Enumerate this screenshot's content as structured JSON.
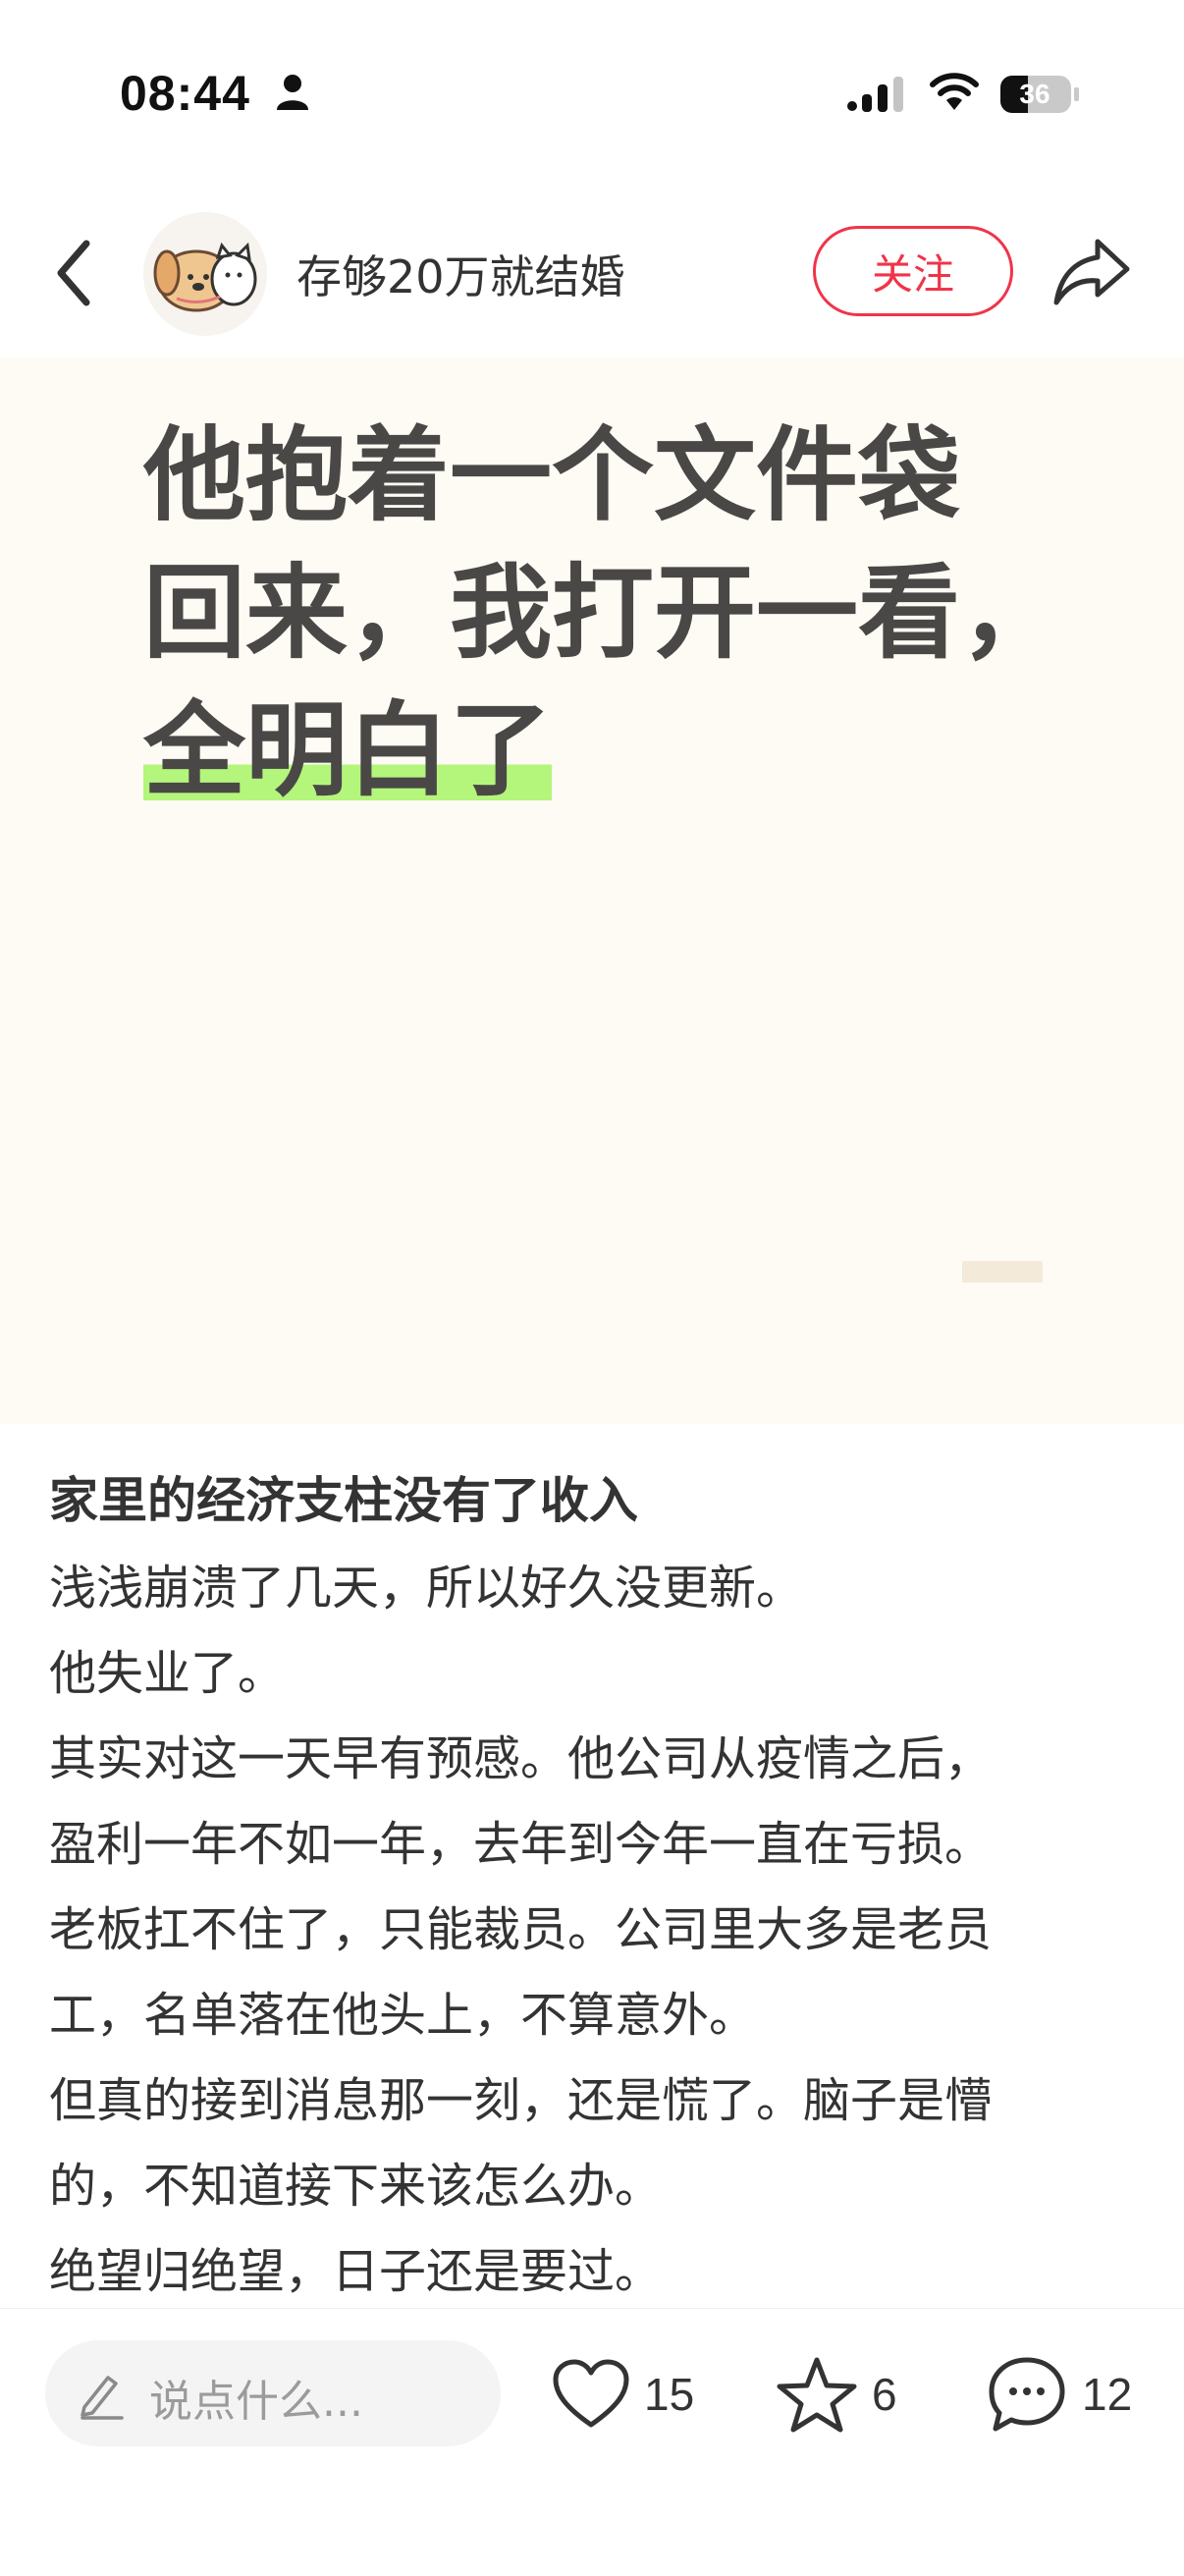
{
  "status_bar": {
    "time": "08:44",
    "battery": "36"
  },
  "header": {
    "author": "存够20万就结婚",
    "follow_label": "关注"
  },
  "cover": {
    "title_lines": [
      "他抱着一个文件袋",
      "回来，我打开一看，",
      "全明白了"
    ]
  },
  "post": {
    "title": "家里的经济支柱没有了收入",
    "lines": [
      "浅浅崩溃了几天，所以好久没更新。",
      "他失业了。",
      "其实对这一天早有预感。他公司从疫情之后，",
      "盈利一年不如一年，去年到今年一直在亏损。",
      "老板扛不住了，只能裁员。公司里大多是老员",
      "工，名单落在他头上，不算意外。",
      "但真的接到消息那一刻，还是慌了。脑子是懵",
      "的，不知道接下来该怎么办。",
      "绝望归绝望，日子还是要过。"
    ]
  },
  "bottom_bar": {
    "comment_placeholder": "说点什么...",
    "like_count": "15",
    "collect_count": "6",
    "comment_count": "12"
  }
}
